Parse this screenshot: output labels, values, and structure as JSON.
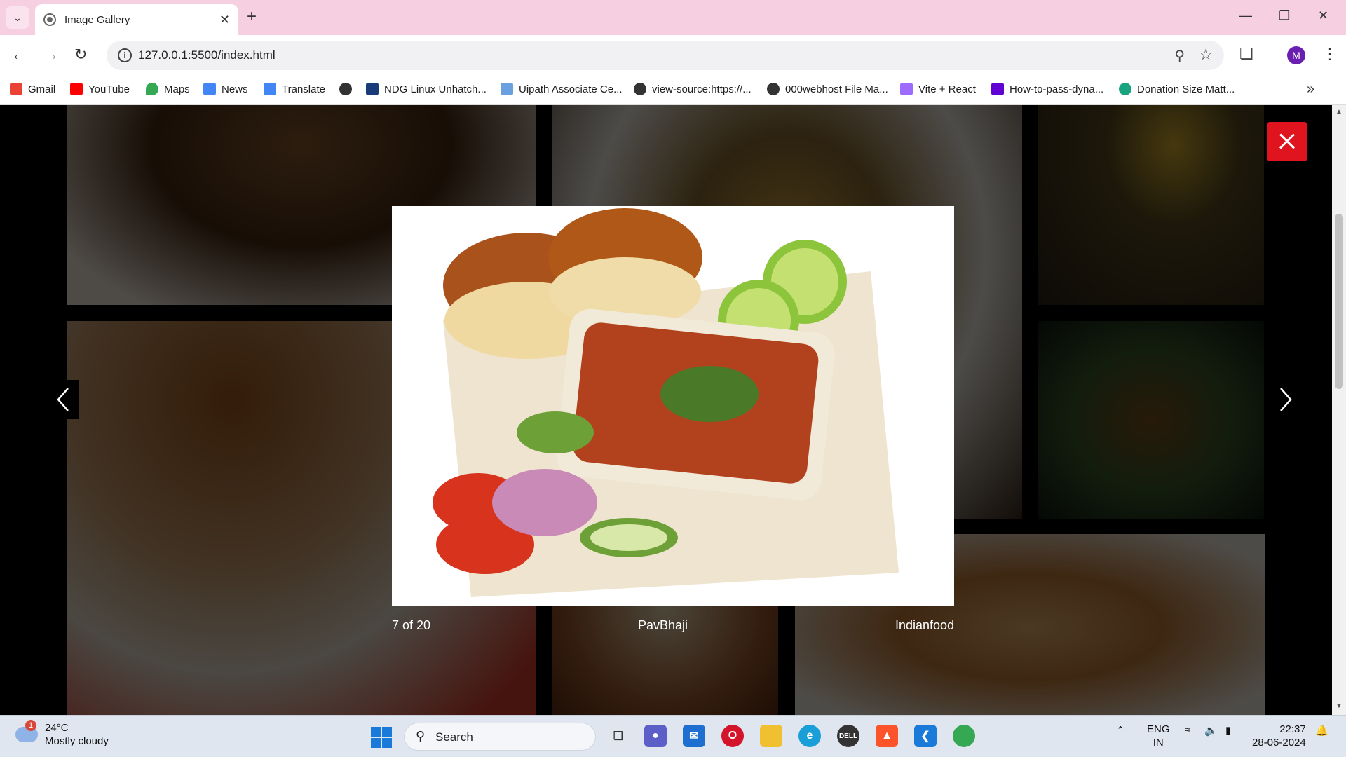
{
  "browser": {
    "tab_title": "Image Gallery",
    "url": "127.0.0.1:5500/index.html",
    "profile_initial": "M",
    "bookmarks": [
      {
        "label": "Gmail",
        "icon": "gmail-icon",
        "color": "#ea4335"
      },
      {
        "label": "YouTube",
        "icon": "youtube-icon",
        "color": "#ff0000"
      },
      {
        "label": "Maps",
        "icon": "maps-icon",
        "color": "#34a853"
      },
      {
        "label": "News",
        "icon": "news-icon",
        "color": "#4285f4"
      },
      {
        "label": "Translate",
        "icon": "translate-icon",
        "color": "#4285f4"
      },
      {
        "label": "",
        "icon": "globe-icon",
        "color": "#333333"
      },
      {
        "label": "NDG Linux Unhatch...",
        "icon": "ndg-icon",
        "color": "#1a3b7a"
      },
      {
        "label": "Uipath Associate Ce...",
        "icon": "uipath-icon",
        "color": "#6aa0e0"
      },
      {
        "label": "view-source:https://...",
        "icon": "globe-icon",
        "color": "#333333"
      },
      {
        "label": "000webhost File Ma...",
        "icon": "globe-icon",
        "color": "#333333"
      },
      {
        "label": "Vite + React",
        "icon": "vite-icon",
        "color": "#9d6cff"
      },
      {
        "label": "How-to-pass-dyna...",
        "icon": "yahoo-icon",
        "color": "#6001d2"
      },
      {
        "label": "Donation Size Matt...",
        "icon": "chatgpt-icon",
        "color": "#19a37f"
      }
    ]
  },
  "lightbox": {
    "counter": "7 of 20",
    "title": "PavBhaji",
    "category": "Indianfood"
  },
  "taskbar": {
    "temperature": "24°C",
    "weather": "Mostly cloudy",
    "weather_badge": "1",
    "search_label": "Search",
    "lang_top": "ENG",
    "lang_bottom": "IN",
    "time": "22:37",
    "date": "28-06-2024"
  }
}
